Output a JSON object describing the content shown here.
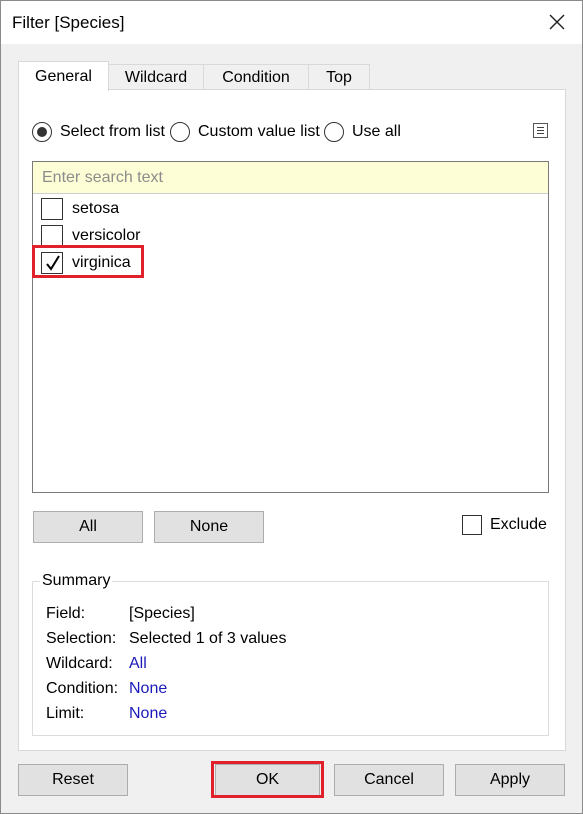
{
  "window": {
    "title": "Filter [Species]"
  },
  "tabs": [
    {
      "label": "General",
      "active": true
    },
    {
      "label": "Wildcard",
      "active": false
    },
    {
      "label": "Condition",
      "active": false
    },
    {
      "label": "Top",
      "active": false
    }
  ],
  "mode_options": [
    {
      "label": "Select from list",
      "selected": true
    },
    {
      "label": "Custom value list",
      "selected": false
    },
    {
      "label": "Use all",
      "selected": false
    }
  ],
  "search": {
    "placeholder": "Enter search text",
    "value": ""
  },
  "list_items": [
    {
      "label": "setosa",
      "checked": false
    },
    {
      "label": "versicolor",
      "checked": false
    },
    {
      "label": "virginica",
      "checked": true
    }
  ],
  "list_buttons": {
    "all": "All",
    "none": "None"
  },
  "exclude": {
    "label": "Exclude",
    "checked": false
  },
  "summary": {
    "legend": "Summary",
    "rows": [
      {
        "label": "Field:",
        "value": "[Species]"
      },
      {
        "label": "Selection:",
        "value": "Selected 1 of 3 values"
      },
      {
        "label": "Wildcard:",
        "value": "All"
      },
      {
        "label": "Condition:",
        "value": "None"
      },
      {
        "label": "Limit:",
        "value": "None"
      }
    ]
  },
  "footer_buttons": {
    "reset": "Reset",
    "ok": "OK",
    "cancel": "Cancel",
    "apply": "Apply"
  },
  "colors": {
    "highlight": "#e0202a",
    "link_value": "#1a1ab8",
    "search_bg": "#fdfdd6"
  }
}
